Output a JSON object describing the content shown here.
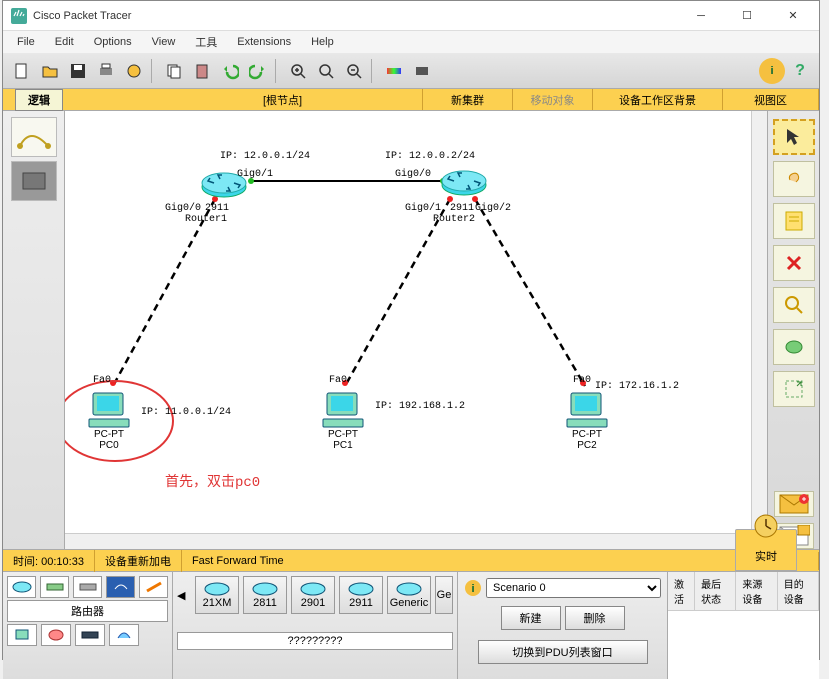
{
  "title": "Cisco Packet Tracer",
  "menu": [
    "File",
    "Edit",
    "Options",
    "View",
    "工具",
    "Extensions",
    "Help"
  ],
  "tabs": {
    "logical": "逻辑",
    "root": "[根节点]",
    "newcluster": "新集群",
    "moveobj": "移动对象",
    "bgset": "设备工作区背景",
    "viewport": "视图区"
  },
  "status": {
    "time_label": "时间:",
    "time": "00:10:33",
    "power": "设备重新加电",
    "fft": "Fast Forward Time",
    "realtime": "实时"
  },
  "topology": {
    "r1": {
      "name": "Router1",
      "model": "2911",
      "if1": "Gig0/1",
      "if0": "Gig0/0",
      "ip": "IP: 12.0.0.1/24"
    },
    "r2": {
      "name": "Router2",
      "model": "2911",
      "if0": "Gig0/0",
      "if1": "Gig0/1",
      "if2": "Gig0/2",
      "ip": "IP: 12.0.0.2/24"
    },
    "pc0": {
      "name": "PC0",
      "type": "PC-PT",
      "if": "Fa0",
      "ip": "IP: 11.0.0.1/24"
    },
    "pc1": {
      "name": "PC1",
      "type": "PC-PT",
      "if": "Fa0",
      "ip": "IP: 192.168.1.2"
    },
    "pc2": {
      "name": "PC2",
      "type": "PC-PT",
      "if": "Fa0",
      "ip": "IP: 172.16.1.2"
    },
    "hint": "首先，双击pc0"
  },
  "scenario": {
    "label": "Scenario 0",
    "new": "新建",
    "delete": "删除",
    "toggle": "切换到PDU列表窗口"
  },
  "pdu": {
    "h1": "激活",
    "h2": "最后状态",
    "h3": "来源设备",
    "h4": "目的设备"
  },
  "devcat": {
    "label": "路由器",
    "devquery": "?????????"
  },
  "devmodels": [
    "21XM",
    "2811",
    "2901",
    "2911",
    "Generic",
    "Ge"
  ]
}
